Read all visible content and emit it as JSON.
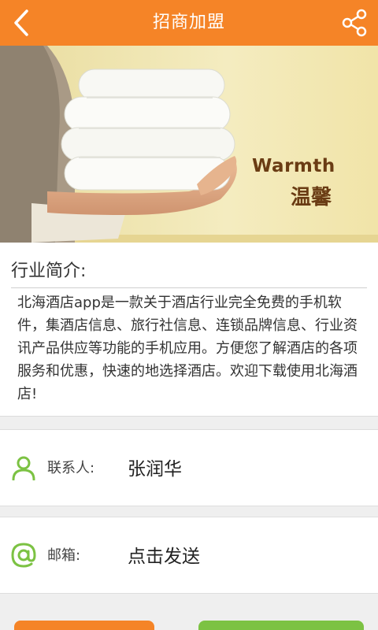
{
  "header": {
    "title": "招商加盟",
    "back_icon": "chevron-left-icon",
    "share_icon": "share-icon",
    "accent_color": "#f58427"
  },
  "banner": {
    "text_en": "Warmth",
    "text_cn": "温馨"
  },
  "intro": {
    "heading": "行业简介:",
    "body": "北海酒店app是一款关于酒店行业完全免费的手机软件，集酒店信息、旅行社信息、连锁品牌信息、行业资讯产品供应等功能的手机应用。方便您了解酒店的各项服务和优惠，快速的地选择酒店。欢迎下载使用北海酒店!"
  },
  "contact": {
    "icon": "person-icon",
    "label": "联系人:",
    "value": "张润华"
  },
  "email": {
    "icon": "at-icon",
    "label": "邮箱:",
    "value": "点击发送"
  },
  "colors": {
    "green": "#7cc243"
  }
}
